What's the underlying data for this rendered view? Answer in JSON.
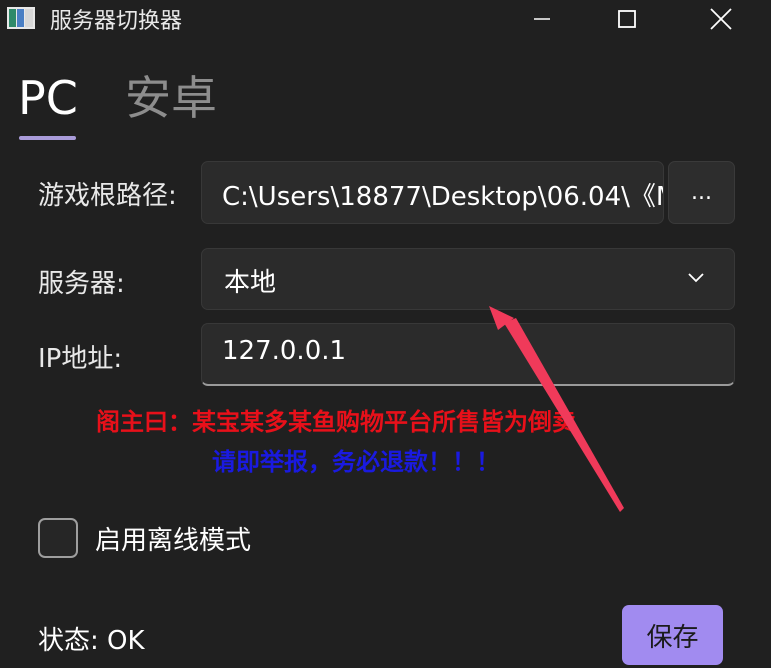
{
  "window": {
    "title": "服务器切换器"
  },
  "tabs": [
    {
      "label": "PC",
      "selected": true
    },
    {
      "label": "安卓",
      "selected": false
    }
  ],
  "form": {
    "game_path_label": "游戏根路径:",
    "game_path_value": "C:\\Users\\18877\\Desktop\\06.04\\《M",
    "browse_label": "...",
    "server_label": "服务器:",
    "server_value": "本地",
    "ip_label": "IP地址:",
    "ip_value": "127.0.0.1"
  },
  "annotation": {
    "line1": "阁主曰：某宝某多某鱼购物平台所售皆为倒卖",
    "line2": "请即举报，务必退款！！！",
    "line1_color": "#e8101a",
    "line2_color": "#1a1ae0",
    "arrow_color": "#f03a5a"
  },
  "offline_mode": {
    "label": "启用离线模式",
    "checked": false
  },
  "status": {
    "text": "状态: OK"
  },
  "save_button": {
    "label": "保存"
  },
  "colors": {
    "accent": "#a18bf0",
    "background": "#202020"
  },
  "icons": [
    "app-icon",
    "minimize-icon",
    "maximize-icon",
    "close-icon",
    "chevron-down-icon"
  ]
}
